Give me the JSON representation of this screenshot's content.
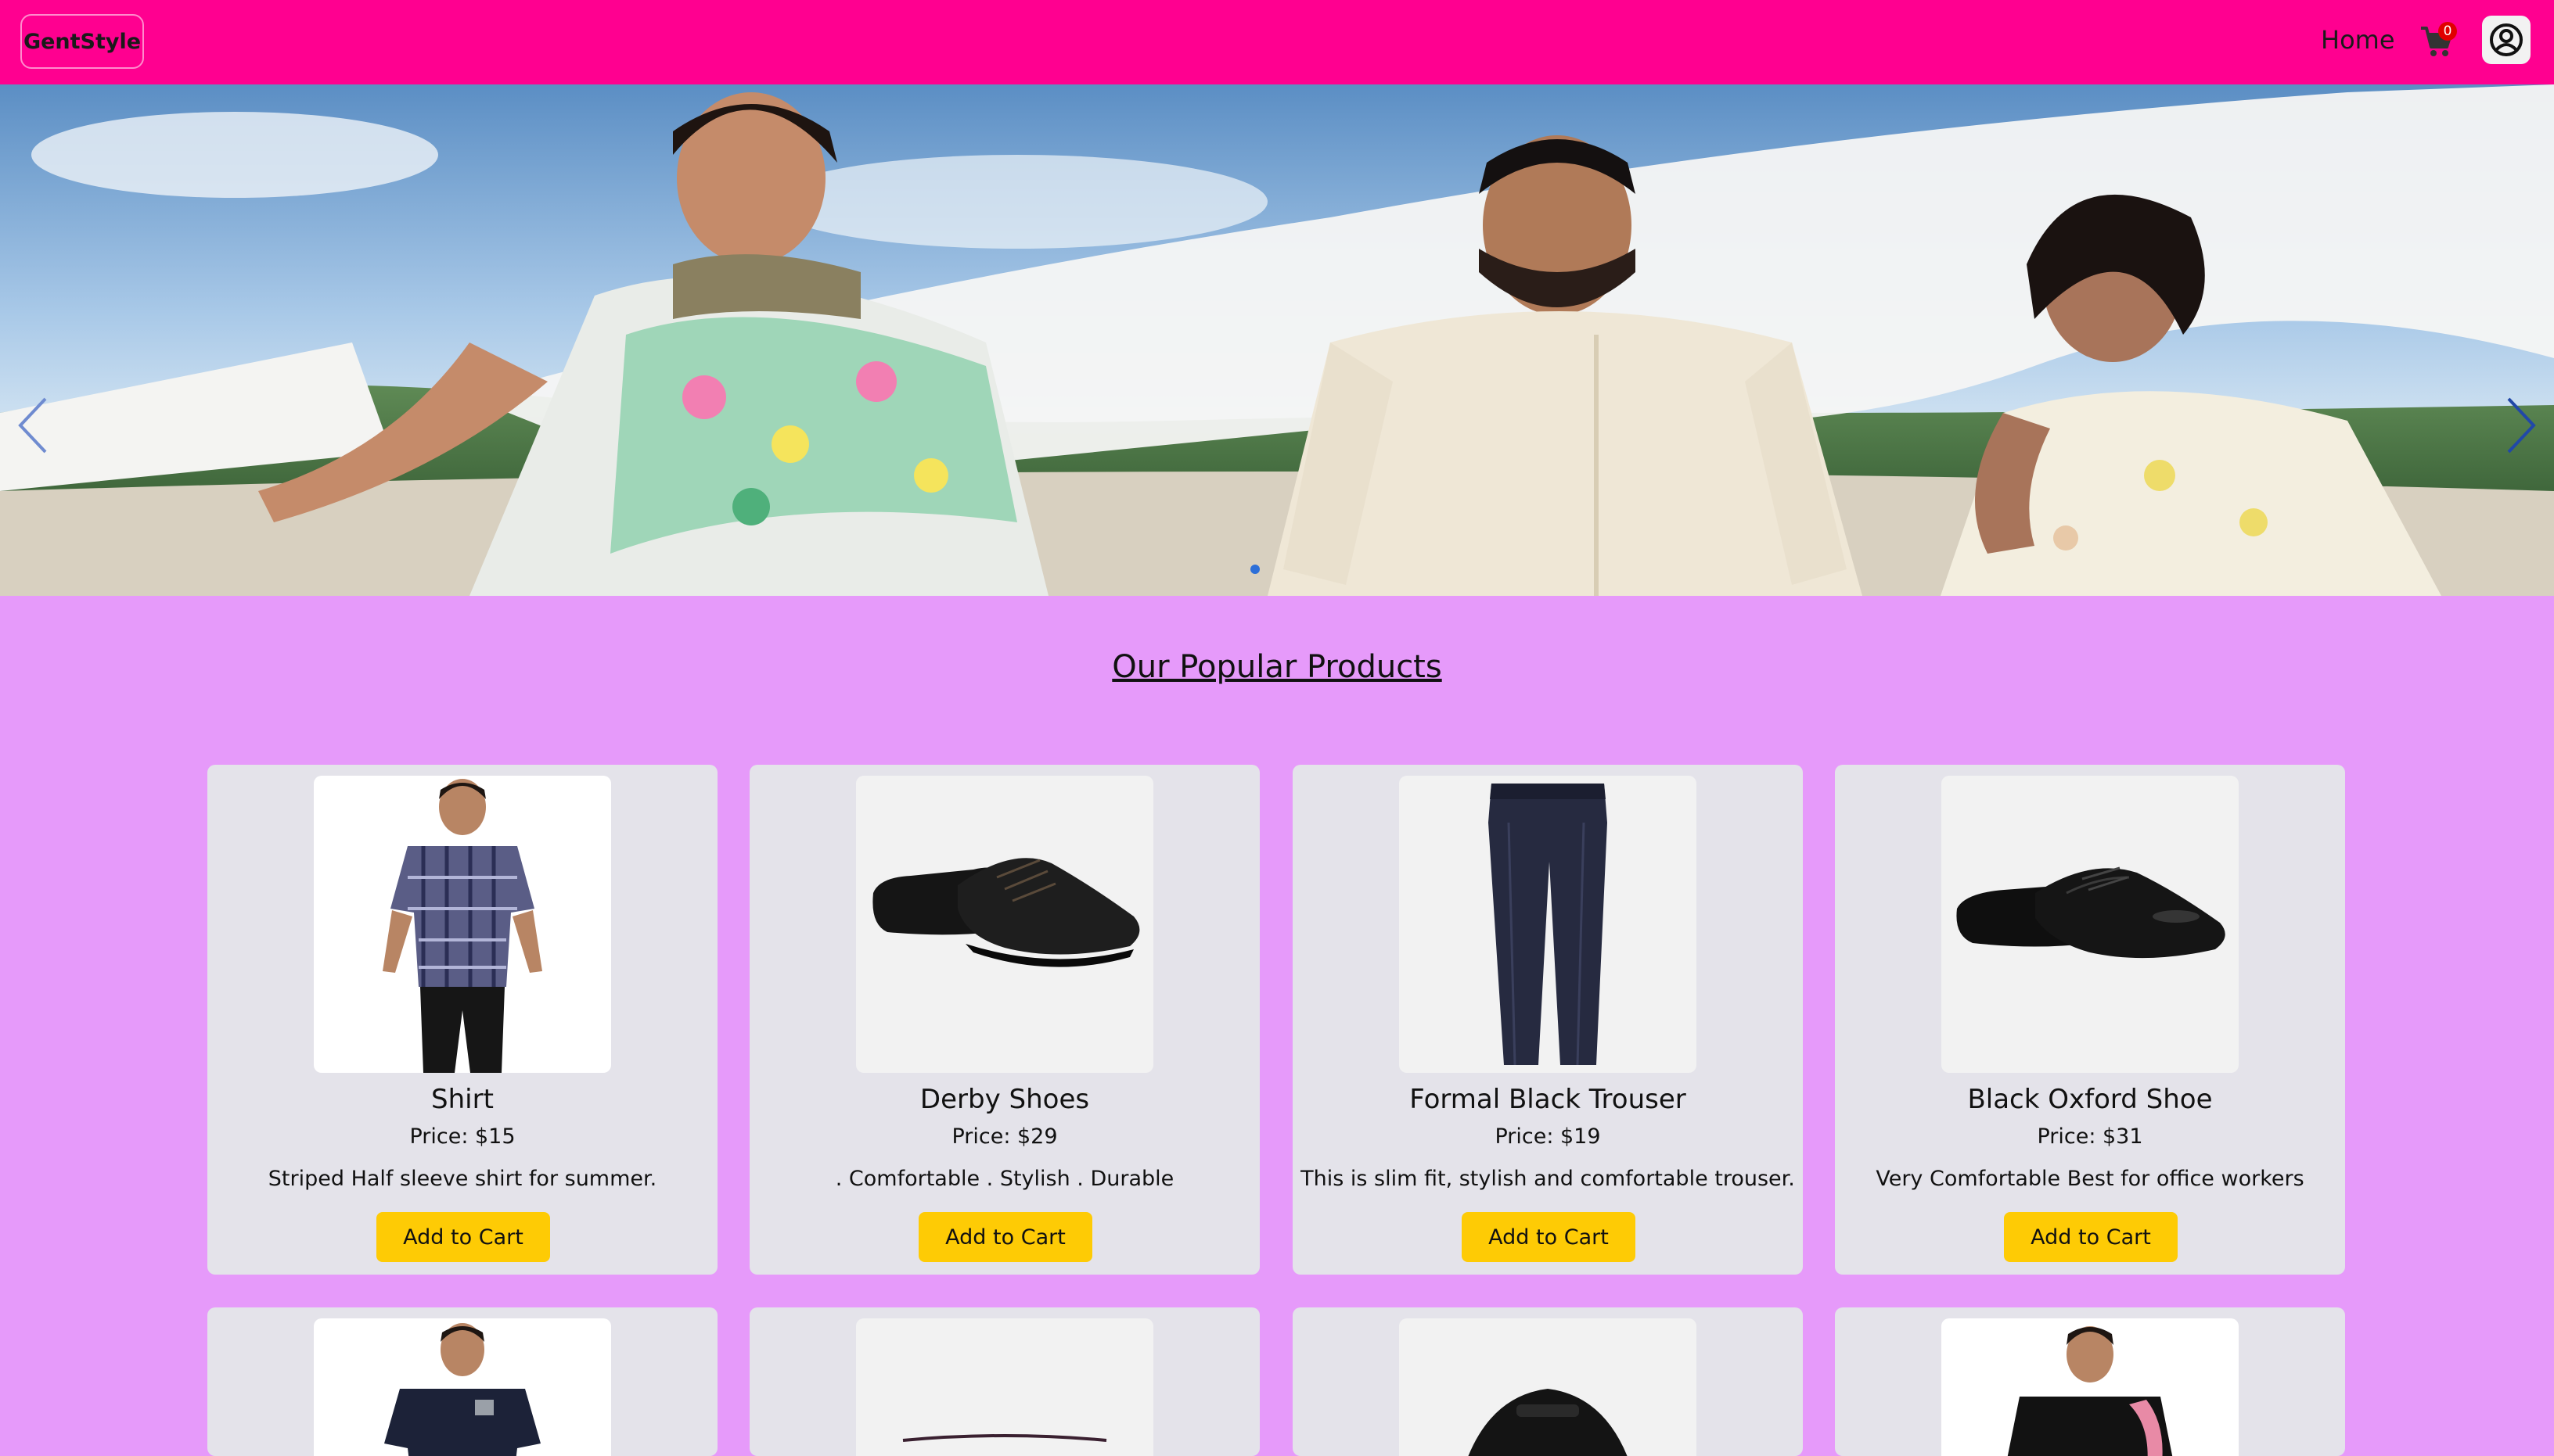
{
  "header": {
    "brand": "GentStyle",
    "nav_home": "Home",
    "cart_count": "0",
    "brand_color": "#ff0090"
  },
  "hero": {
    "slide_count": 1,
    "active_slide": 1
  },
  "products": {
    "section_title": "Our Popular Products",
    "add_label": "Add to Cart",
    "items": [
      {
        "name": "Shirt",
        "price": "Price: $15",
        "description": "Striped Half sleeve shirt for summer."
      },
      {
        "name": "Derby Shoes",
        "price": "Price: $29",
        "description": ". Comfortable . Stylish . Durable"
      },
      {
        "name": "Formal Black Trouser",
        "price": "Price: $19",
        "description": "This is slim fit, stylish and comfortable trouser."
      },
      {
        "name": "Black Oxford Shoe",
        "price": "Price: $31",
        "description": "Very Comfortable Best for office workers"
      }
    ]
  },
  "colors": {
    "background": "#e69afa",
    "card": "#e4e3ea",
    "button": "#fecb05"
  }
}
